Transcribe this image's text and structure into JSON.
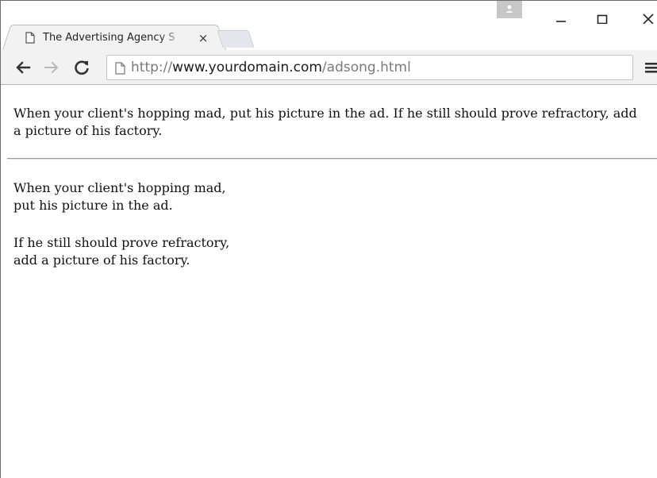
{
  "browser": {
    "tab": {
      "title": "The Advertising Agency S",
      "close_glyph": "×"
    },
    "window_controls": {
      "minimize": "–",
      "maximize": "☐",
      "close": "×"
    },
    "address_bar": {
      "url_prefix": "http://",
      "url_host": "www.yourdomain.com",
      "url_path": "/adsong.html"
    }
  },
  "page": {
    "paragraph": {
      "line1": "When your client's hopping mad, put his picture in the ad. If he still should prove refractory, add",
      "line2": "a picture of his factory."
    },
    "stanza1": {
      "line1": "When your client's hopping mad,",
      "line2": "put his picture in the ad."
    },
    "stanza2": {
      "line1": "If he still should prove refractory,",
      "line2": "add a picture of his factory."
    }
  }
}
